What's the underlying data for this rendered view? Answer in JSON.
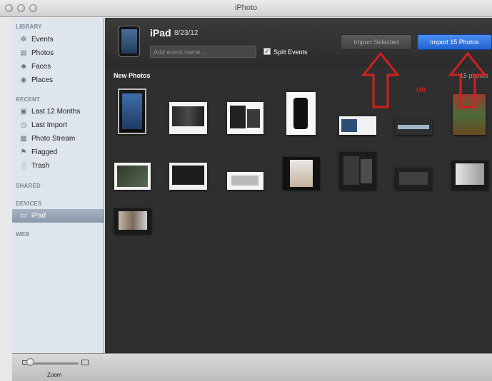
{
  "window": {
    "title": "iPhoto"
  },
  "sidebar": {
    "sections": {
      "library": "LIBRARY",
      "recent": "RECENT",
      "shared": "SHARED",
      "devices": "DEVICES",
      "web": "WEB"
    },
    "library_items": [
      "Events",
      "Photos",
      "Faces",
      "Places"
    ],
    "recent_items": [
      "Last 12 Months",
      "Last Import",
      "Photo Stream",
      "Flagged",
      "Trash"
    ],
    "device_items": [
      "iPad"
    ]
  },
  "header": {
    "device_name": "iPad",
    "date": "8/23/12",
    "event_placeholder": "Add event name...",
    "split_events_label": "Split Events",
    "split_events_checked": true,
    "import_selected_label": "Import Selected",
    "import_all_label": "Import 15 Photos"
  },
  "content": {
    "section_title": "New Photos",
    "count_label": "15 photos",
    "or_label": "OR",
    "photo_count": 15
  },
  "bottom": {
    "zoom_label": "Zoom"
  },
  "colors": {
    "annotation_red": "#d12020",
    "import_blue": "#2d6fdc",
    "selection": "#8b99ab"
  }
}
